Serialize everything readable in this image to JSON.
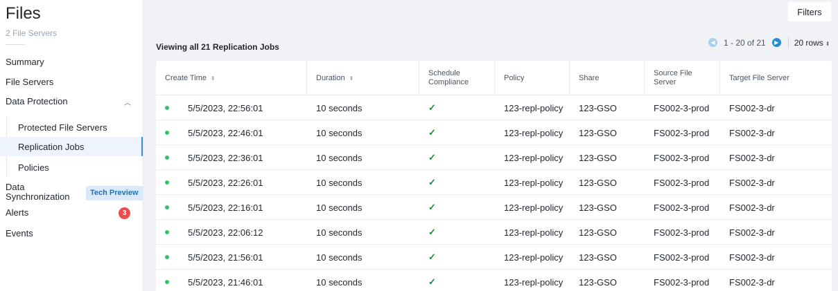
{
  "sidebar": {
    "title": "Files",
    "subtitle": "2 File Servers",
    "items": [
      {
        "label": "Summary"
      },
      {
        "label": "File Servers"
      },
      {
        "label": "Data Protection"
      },
      {
        "label": "Protected File Servers"
      },
      {
        "label": "Replication Jobs"
      },
      {
        "label": "Policies"
      },
      {
        "label": "Data Synchronization"
      },
      {
        "label": "Alerts"
      },
      {
        "label": "Events"
      }
    ],
    "tech_preview_badge": "Tech Preview",
    "alerts_count": "3"
  },
  "toolbar": {
    "filters_label": "Filters"
  },
  "main": {
    "viewing_title": "Viewing all 21 Replication Jobs",
    "pager": {
      "range": "1 - 20 of 21",
      "rows_label": "20 rows"
    }
  },
  "table": {
    "headers": [
      "Create Time",
      "Duration",
      "Schedule Compliance",
      "Policy",
      "Share",
      "Source File Server",
      "Target File Server"
    ],
    "rows": [
      {
        "create_time": "5/5/2023, 22:56:01",
        "duration": "10 seconds",
        "compliance": "✓",
        "policy": "123-repl-policy",
        "share": "123-GSO",
        "source": "FS002-3-prod",
        "target": "FS002-3-dr"
      },
      {
        "create_time": "5/5/2023, 22:46:01",
        "duration": "10 seconds",
        "compliance": "✓",
        "policy": "123-repl-policy",
        "share": "123-GSO",
        "source": "FS002-3-prod",
        "target": "FS002-3-dr"
      },
      {
        "create_time": "5/5/2023, 22:36:01",
        "duration": "10 seconds",
        "compliance": "✓",
        "policy": "123-repl-policy",
        "share": "123-GSO",
        "source": "FS002-3-prod",
        "target": "FS002-3-dr"
      },
      {
        "create_time": "5/5/2023, 22:26:01",
        "duration": "10 seconds",
        "compliance": "✓",
        "policy": "123-repl-policy",
        "share": "123-GSO",
        "source": "FS002-3-prod",
        "target": "FS002-3-dr"
      },
      {
        "create_time": "5/5/2023, 22:16:01",
        "duration": "10 seconds",
        "compliance": "✓",
        "policy": "123-repl-policy",
        "share": "123-GSO",
        "source": "FS002-3-prod",
        "target": "FS002-3-dr"
      },
      {
        "create_time": "5/5/2023, 22:06:12",
        "duration": "10 seconds",
        "compliance": "✓",
        "policy": "123-repl-policy",
        "share": "123-GSO",
        "source": "FS002-3-prod",
        "target": "FS002-3-dr"
      },
      {
        "create_time": "5/5/2023, 21:56:01",
        "duration": "10 seconds",
        "compliance": "✓",
        "policy": "123-repl-policy",
        "share": "123-GSO",
        "source": "FS002-3-prod",
        "target": "FS002-3-dr"
      },
      {
        "create_time": "5/5/2023, 21:46:01",
        "duration": "10 seconds",
        "compliance": "✓",
        "policy": "123-repl-policy",
        "share": "123-GSO",
        "source": "FS002-3-prod",
        "target": "FS002-3-dr"
      }
    ]
  },
  "colors": {
    "accent": "#2a8bd8",
    "status_success": "#36c26b",
    "alert_badge": "#ec4c4c"
  }
}
